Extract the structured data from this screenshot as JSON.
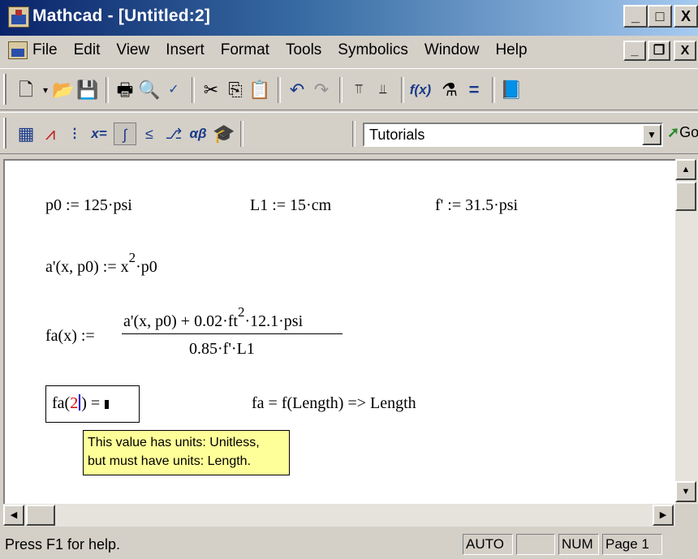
{
  "window": {
    "title": "Mathcad - [Untitled:2]",
    "caption_buttons": {
      "minimize": "_",
      "maximize": "□",
      "close": "X"
    }
  },
  "menu": {
    "items": [
      "File",
      "Edit",
      "View",
      "Insert",
      "Format",
      "Tools",
      "Symbolics",
      "Window",
      "Help"
    ],
    "mdi_buttons": {
      "minimize": "_",
      "restore": "❐",
      "close": "X"
    }
  },
  "standard_toolbar": {
    "icons": [
      "new-document-icon",
      "open-folder-icon",
      "save-icon",
      "print-icon",
      "print-preview-icon",
      "spell-check-icon",
      "cut-icon",
      "copy-icon",
      "paste-icon",
      "undo-icon",
      "redo-icon",
      "align-top-icon",
      "align-down-icon",
      "insert-function-icon",
      "insert-unit-icon",
      "calculate-icon",
      "resource-center-icon"
    ]
  },
  "math_toolbar": {
    "icons": [
      "calculator-icon",
      "graph-icon",
      "matrix-icon",
      "evaluation-icon",
      "calculus-icon",
      "boolean-icon",
      "programming-icon",
      "greek-icon",
      "symbolic-icon"
    ],
    "resource_select": {
      "value": "Tutorials"
    },
    "go_label": "Go"
  },
  "worksheet": {
    "defs": {
      "p0": "p0 := 125·psi",
      "L1": "L1 := 15·cm",
      "f": "f' := 31.5·psi"
    },
    "a_def": {
      "lhs": "a'(x, p0) := x",
      "exp": "2",
      "rhs": "·p0"
    },
    "fa_def": {
      "lhs": "fa(x) :=",
      "num_a": "a'(x, p0)  + 0.02·ft",
      "num_exp": "2",
      "num_b": "·12.1·psi",
      "den": "0.85·f'·L1"
    },
    "eval": {
      "name": "fa(",
      "arg": "2",
      "close": ")",
      "equals": "="
    },
    "comment": "fa = f(Length) => Length",
    "tooltip": {
      "line1": "This value has units: Unitless,",
      "line2": "but must have units: Length."
    }
  },
  "statusbar": {
    "help": "Press F1 for help.",
    "mode": "AUTO",
    "blank": "",
    "num": "NUM",
    "page": "Page 1"
  }
}
